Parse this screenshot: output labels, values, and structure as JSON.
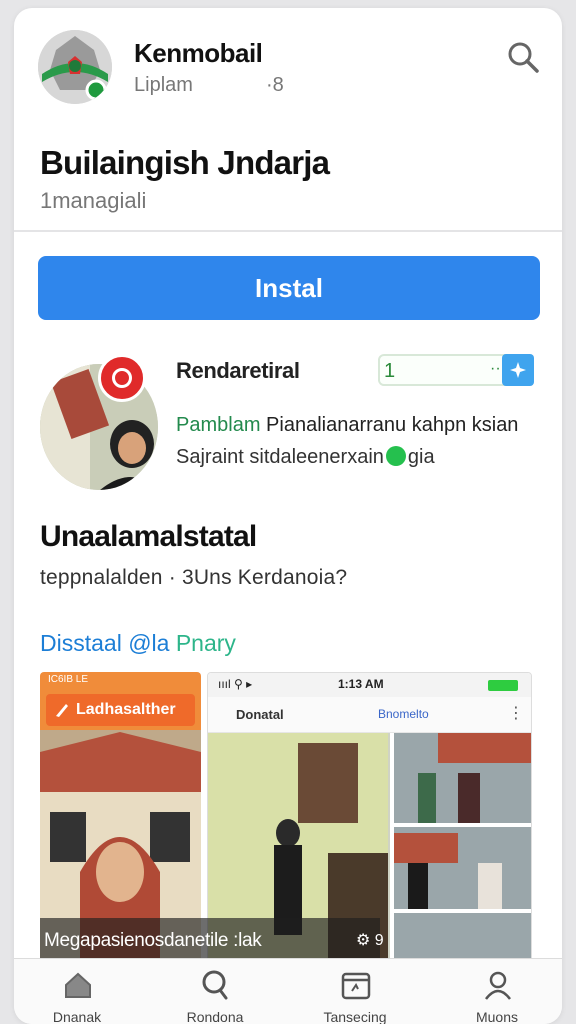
{
  "app": {
    "title": "Kenmobail",
    "subtitle": "Liplam",
    "count": "·8"
  },
  "page": {
    "title": "Builaingish Jndarja",
    "subtitle": "1managiali"
  },
  "install_button": "Instal",
  "profile": {
    "name": "Rendaretiral",
    "stat_value": "1",
    "stat_dots": "··",
    "line_a_highlight": "Pamblam",
    "line_a_rest": " Pianalianarranu kahpn ksian",
    "line_b_start": "Sajraint sitdaleenerxain",
    "line_b_end": "gia"
  },
  "section": {
    "title": "Unaalamalstatal",
    "subtitle": "teppnalalden · 3Uns Kerdanoia?",
    "link_blue": "Disstaal @la",
    "link_green": "Pnary"
  },
  "gallery": {
    "shot1_status": "IC6IB LE",
    "shot1_label": "Ladhasalther",
    "shot2_status_icons": "ıııl ⚲ ▸",
    "shot2_time": "1:13 AM",
    "shot2_tab1": "Donatal",
    "shot2_tab2": "Bnomelto",
    "caption": "Megapasienosdanetile :lak",
    "caption_icon": "⚙ 9"
  },
  "bottom_nav": [
    {
      "label": "Dnanak",
      "icon": "home-icon"
    },
    {
      "label": "Rondona",
      "icon": "search-icon"
    },
    {
      "label": "Tansecing",
      "icon": "calendar-icon"
    },
    {
      "label": "Muons",
      "icon": "profile-icon"
    }
  ],
  "colors": {
    "accent": "#2f86ec",
    "record": "#e02a2a",
    "link": "#1c7ed6",
    "link_secondary": "#2db58a",
    "shot_header": "#f08c3a"
  }
}
